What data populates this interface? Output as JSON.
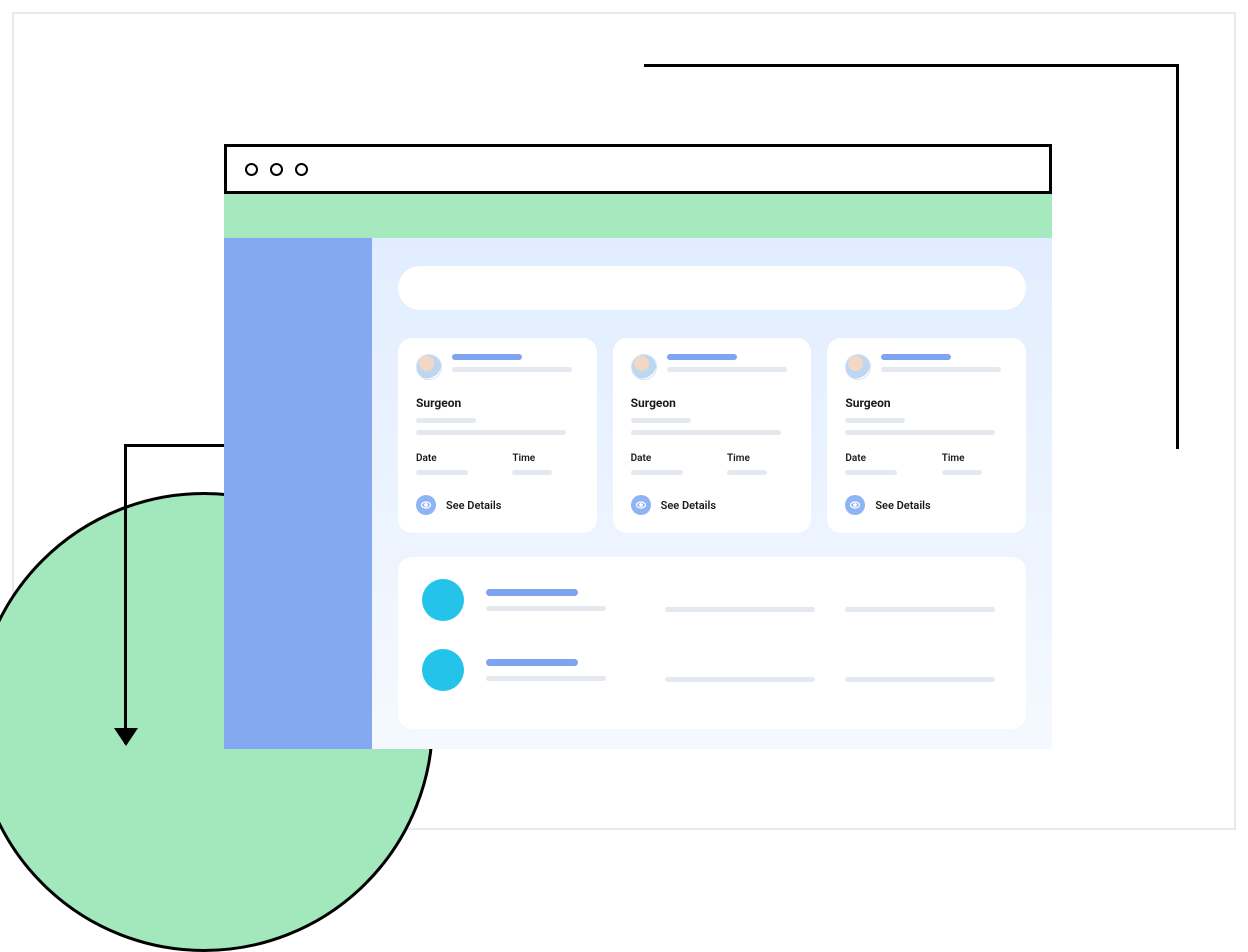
{
  "search": {
    "placeholder": ""
  },
  "cards": [
    {
      "role": "Surgeon",
      "date_label": "Date",
      "time_label": "Time",
      "action_label": "See Details"
    },
    {
      "role": "Surgeon",
      "date_label": "Date",
      "time_label": "Time",
      "action_label": "See Details"
    },
    {
      "role": "Surgeon",
      "date_label": "Date",
      "time_label": "Time",
      "action_label": "See Details"
    }
  ],
  "colors": {
    "accent_green": "#a7e9be",
    "sidebar_blue": "#85a8f2",
    "bar_blue": "#7ea3f0",
    "avatar_cyan": "#24c3ea"
  }
}
